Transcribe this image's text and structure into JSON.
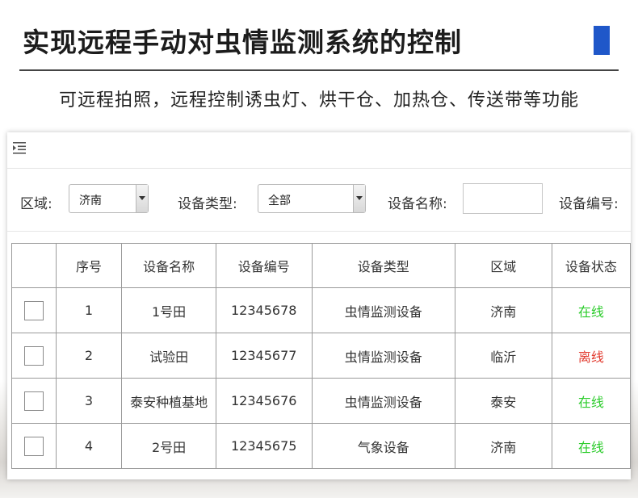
{
  "headline": "实现远程手动对虫情监测系统的控制",
  "subtitle": "可远程拍照，远程控制诱虫灯、烘干仓、加热仓、传送带等功能",
  "colors": {
    "accent": "#1f57c9",
    "online": "#2bcc2b",
    "offline": "#e23b2f"
  },
  "topbar": {
    "menu_icon": "indent-menu-icon"
  },
  "filters": {
    "region_label": "区域:",
    "region_value": "济南",
    "type_label": "设备类型:",
    "type_value": "全部",
    "name_label": "设备名称:",
    "name_value": "",
    "code_label": "设备编号:"
  },
  "table": {
    "headers": [
      "",
      "序号",
      "设备名称",
      "设备编号",
      "设备类型",
      "区域",
      "设备状态"
    ],
    "rows": [
      {
        "no": "1",
        "name": "1号田",
        "code": "12345678",
        "type": "虫情监测设备",
        "region": "济南",
        "status": "在线",
        "status_kind": "online"
      },
      {
        "no": "2",
        "name": "试验田",
        "code": "12345677",
        "type": "虫情监测设备",
        "region": "临沂",
        "status": "离线",
        "status_kind": "offline"
      },
      {
        "no": "3",
        "name": "泰安种植基地",
        "code": "12345676",
        "type": "虫情监测设备",
        "region": "泰安",
        "status": "在线",
        "status_kind": "online"
      },
      {
        "no": "4",
        "name": "2号田",
        "code": "12345675",
        "type": "气象设备",
        "region": "济南",
        "status": "在线",
        "status_kind": "online"
      }
    ]
  }
}
